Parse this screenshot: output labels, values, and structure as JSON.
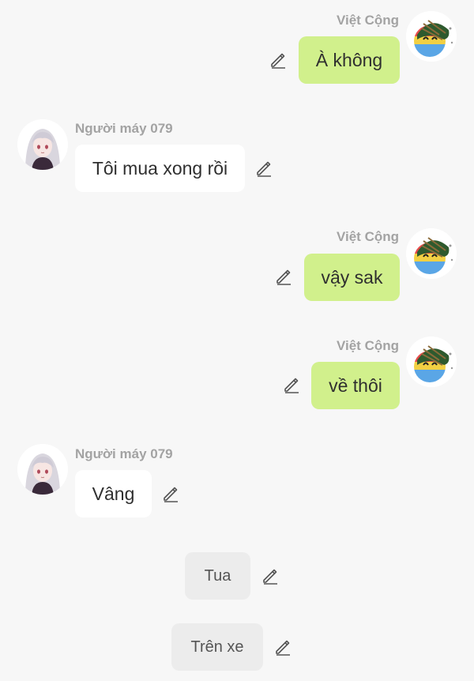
{
  "messages": [
    {
      "side": "me",
      "sender": "Việt Cộng",
      "text": "À không"
    },
    {
      "side": "other",
      "sender": "Người máy 079",
      "text": "Tôi mua xong rồi"
    },
    {
      "side": "me",
      "sender": "Việt Cộng",
      "text": "vậy sak"
    },
    {
      "side": "me",
      "sender": "Việt Cộng",
      "text": "về thôi"
    },
    {
      "side": "other",
      "sender": "Người máy 079",
      "text": "Vâng"
    },
    {
      "side": "system",
      "text": "Tua"
    },
    {
      "side": "system",
      "text": "Trên xe"
    }
  ],
  "icons": {
    "edit": "pencil-edit-icon",
    "avatar_me": "green-hat-ball-avatar",
    "avatar_other": "white-haired-girl-avatar"
  },
  "colors": {
    "background": "#f7f7f7",
    "bubble_me": "#d1f08c",
    "bubble_other": "#ffffff",
    "bubble_system": "#ececec",
    "sender_name": "#a3a3a3"
  }
}
